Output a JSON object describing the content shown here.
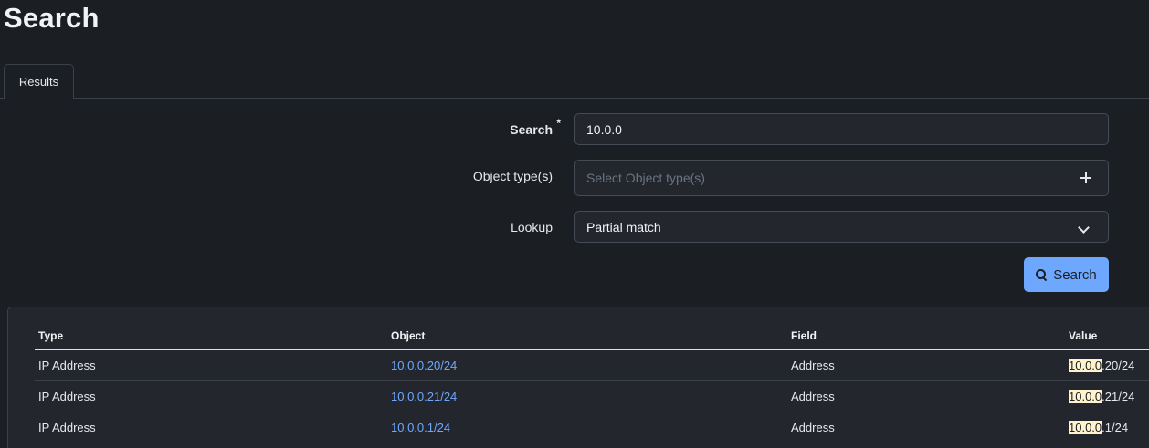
{
  "page": {
    "title": "Search"
  },
  "tabs": [
    {
      "label": "Results"
    }
  ],
  "form": {
    "search_label": "Search",
    "search_required_mark": "*",
    "search_value": "10.0.0",
    "object_types_label": "Object type(s)",
    "object_types_placeholder": "Select Object type(s)",
    "lookup_label": "Lookup",
    "lookup_value": "Partial match",
    "submit_label": "Search"
  },
  "results": {
    "columns": [
      "Type",
      "Object",
      "Field",
      "Value"
    ],
    "rows": [
      {
        "type": "IP Address",
        "object": "10.0.0.20/24",
        "field": "Address",
        "value_match": "10.0.0",
        "value_rest": ".20/24"
      },
      {
        "type": "IP Address",
        "object": "10.0.0.21/24",
        "field": "Address",
        "value_match": "10.0.0",
        "value_rest": ".21/24"
      },
      {
        "type": "IP Address",
        "object": "10.0.0.1/24",
        "field": "Address",
        "value_match": "10.0.0",
        "value_rest": ".1/24"
      }
    ]
  },
  "colors": {
    "background": "#1b1f24",
    "surface": "#23272d",
    "accent": "#6ea8fe",
    "highlight": "#fff3cd"
  }
}
